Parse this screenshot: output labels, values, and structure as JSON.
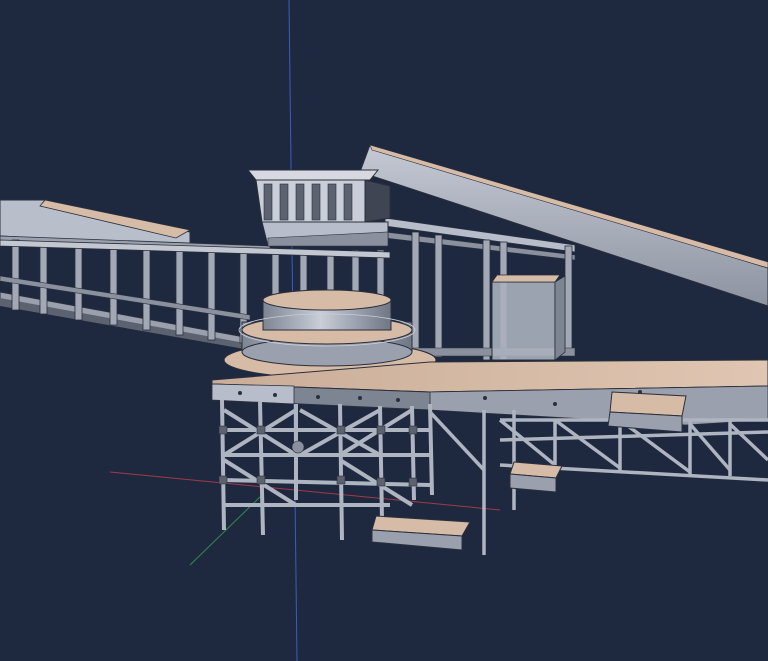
{
  "viewport": {
    "background_color": "#1e2940",
    "axes": {
      "z_axis_color": "#3b5bc4",
      "x_axis_color": "#a03a4a",
      "y_axis_color": "#2f8a4a"
    },
    "model": {
      "frame_color": "#9aa0ad",
      "frame_dark_color": "#5c6270",
      "panel_light_color": "#b7bdca",
      "deck_color": "#d6bba6",
      "outline_color": "#2a2f3a"
    }
  }
}
